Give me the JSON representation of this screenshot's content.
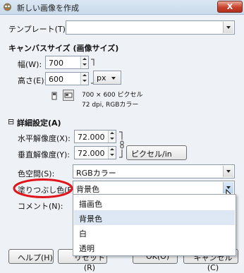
{
  "window": {
    "title": "新しい画像を作成",
    "close_glyph": "X"
  },
  "template": {
    "label": "テンプレート(T):",
    "value": ""
  },
  "canvas": {
    "heading": "キャンバスサイズ (画像サイズ)",
    "width_label": "幅(W):",
    "width_value": "700",
    "height_label": "高さ(E):",
    "height_value": "600",
    "unit": "px",
    "info_size": "700 × 600 ピクセル",
    "info_res": "72 dpi, RGBカラー"
  },
  "advanced": {
    "heading": "詳細設定(A)",
    "expander_glyph": "⊟",
    "xres_label": "水平解像度(X):",
    "xres_value": "72.000",
    "yres_label": "垂直解像度(Y):",
    "yres_value": "72.000",
    "res_unit": "ピクセル/in",
    "colorspace_label": "色空間(S):",
    "colorspace_value": "RGBカラー",
    "fill_label": "塗りつぶし色(F):",
    "fill_value": "背景色",
    "comment_label": "コメント(N):"
  },
  "fill_menu": {
    "items": [
      "描画色",
      "背景色",
      "白",
      "透明"
    ],
    "selected": "背景色"
  },
  "buttons": {
    "help": "ヘルプ(H)",
    "reset": "リセット(R)",
    "ok": "OK(O)",
    "cancel": "キャンセル(C)"
  },
  "colors": {
    "annotation_red": "#e0141b",
    "highlight": "#dde8f4"
  }
}
